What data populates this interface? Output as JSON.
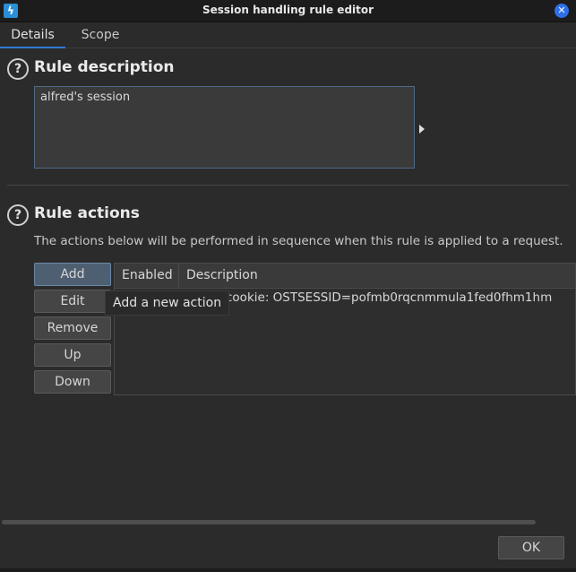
{
  "window": {
    "title": "Session handling rule editor",
    "app_icon": "lightning-icon",
    "close_icon": "close-icon"
  },
  "tabs": [
    {
      "label": "Details",
      "active": true
    },
    {
      "label": "Scope",
      "active": false
    }
  ],
  "rule_description": {
    "heading": "Rule description",
    "value": "alfred's session",
    "help_icon": "help-icon"
  },
  "rule_actions": {
    "heading": "Rule actions",
    "help_icon": "help-icon",
    "explanation": "The actions below will be performed in sequence when this rule is applied to a request.",
    "buttons": {
      "add": "Add",
      "edit": "Edit",
      "remove": "Remove",
      "up": "Up",
      "down": "Down"
    },
    "table": {
      "columns": [
        "Enabled",
        "Description"
      ],
      "rows": [
        {
          "enabled": true,
          "description": "cookie: OSTSESSID=pofmb0rqcnmmula1fed0fhm1hm"
        }
      ]
    },
    "tooltip": "Add a new action"
  },
  "footer": {
    "ok_label": "OK"
  },
  "colors": {
    "accent": "#2e7bd6",
    "close_button": "#2f6fe8",
    "background": "#2b2b2b"
  }
}
